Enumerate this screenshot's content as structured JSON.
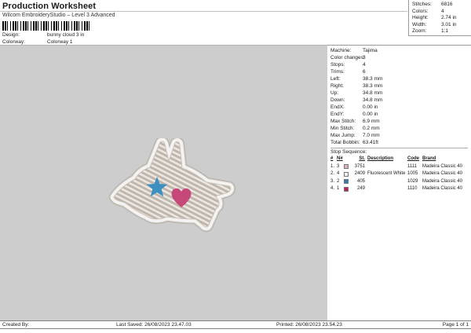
{
  "header": {
    "title": "Production Worksheet",
    "subtitle": "Wilcom EmbroideryStudio – Level 3 Advanced",
    "design_label": "Design:",
    "design_value": "bunny cloud 3 in",
    "colorway_label": "Colorway:",
    "colorway_value": "Colorway 1"
  },
  "summary": {
    "rows": [
      {
        "label": "Stitches:",
        "value": "6816"
      },
      {
        "label": "Colors:",
        "value": "4"
      },
      {
        "label": "Height:",
        "value": "2.74 in"
      },
      {
        "label": "Width:",
        "value": "3.01 in"
      },
      {
        "label": "Zoom:",
        "value": "1:1"
      }
    ]
  },
  "machine_info": {
    "rows": [
      {
        "label": "Machine:",
        "value": "Tajima"
      },
      {
        "label": "Color changes:",
        "value": "3"
      },
      {
        "label": "Stops:",
        "value": "4"
      },
      {
        "label": "Trims:",
        "value": "6"
      },
      {
        "label": "Left:",
        "value": "38.3 mm"
      },
      {
        "label": "Right:",
        "value": "38.3 mm"
      },
      {
        "label": "Up:",
        "value": "34.8 mm"
      },
      {
        "label": "Down:",
        "value": "34.8 mm"
      },
      {
        "label": "EndX:",
        "value": "0.00 in"
      },
      {
        "label": "EndY:",
        "value": "0.00 in"
      },
      {
        "label": "Max Stitch:",
        "value": "6.9 mm"
      },
      {
        "label": "Min Stitch:",
        "value": "0.2 mm"
      },
      {
        "label": "Max Jump:",
        "value": "7.0 mm"
      },
      {
        "label": "Total Bobbin:",
        "value": "63.41ft"
      }
    ]
  },
  "stop_sequence": {
    "title": "Stop Sequence:",
    "columns": [
      "#",
      "N#",
      "St.",
      "Description",
      "Code",
      "Brand"
    ],
    "rows": [
      {
        "num": "1.",
        "n": "3",
        "swatch": "#dcb0c6",
        "st": "3751",
        "description": "",
        "code": "1111",
        "brand": "Madeira Classic 40"
      },
      {
        "num": "2.",
        "n": "4",
        "swatch": "#eef2f8",
        "st": "2409",
        "description": "Fluorescent White",
        "code": "1005",
        "brand": "Madeira Classic 40"
      },
      {
        "num": "3.",
        "n": "2",
        "swatch": "#3779bd",
        "st": "405",
        "description": "",
        "code": "1029",
        "brand": "Madeira Classic 40"
      },
      {
        "num": "4.",
        "n": "1",
        "swatch": "#c2195f",
        "st": "249",
        "description": "",
        "code": "1110",
        "brand": "Madeira Classic 40"
      }
    ]
  },
  "design_preview": {
    "name": "leaping bunny appliqué with star and heart",
    "star_color": "#3d8fc2",
    "heart_color": "#c64878",
    "thread_light": "#ece8e4",
    "thread_shade": "#c1b6ac",
    "border_white": "#f5f3f1",
    "edge_grey": "#bfbab3"
  },
  "footer": {
    "created_by": "Created By:",
    "last_saved": "Last Saved: 26/08/2023 23.47.03",
    "printed": "Printed: 26/08/2023 23.54.23",
    "page": "Page 1 of 1"
  }
}
